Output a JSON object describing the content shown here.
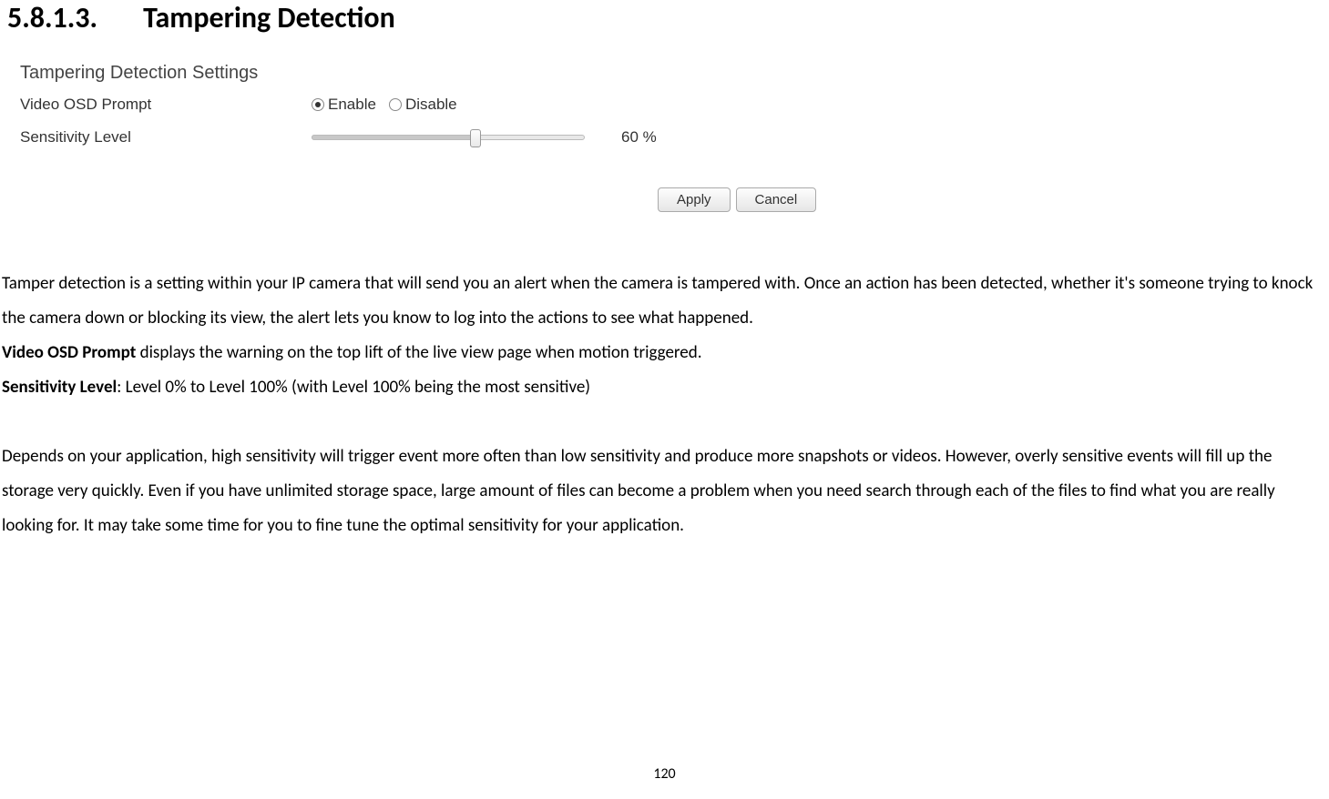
{
  "heading": {
    "number": "5.8.1.3.",
    "title": "Tampering Detection"
  },
  "panel": {
    "title": "Tampering Detection Settings",
    "osd": {
      "label": "Video OSD Prompt",
      "enable": "Enable",
      "disable": "Disable"
    },
    "sensitivity": {
      "label": "Sensitivity Level",
      "value": "60 %"
    },
    "buttons": {
      "apply": "Apply",
      "cancel": "Cancel"
    }
  },
  "text": {
    "p1": "Tamper detection is a setting within your IP camera that will send you an alert when the camera is tampered with. Once an action has been detected, whether it's someone trying to knock the camera down or blocking its view, the alert lets you know to log into the actions to see what happened.",
    "p2a": "Video OSD Prompt",
    "p2b": " displays the warning on the top lift of the live view page when motion triggered.",
    "p3a": "Sensitivity Level",
    "p3b": ": Level 0% to Level 100% (with Level 100% being the most sensitive)",
    "p4": "Depends on your application, high sensitivity will trigger event more often than low sensitivity and produce more snapshots or videos. However, overly sensitive events will fill up the storage very quickly. Even if you have unlimited storage space, large amount of files can become a problem when you need search through each of the files to find what you are really looking for. It may take some time for you to fine tune the optimal sensitivity for your application."
  },
  "page_number": "120"
}
